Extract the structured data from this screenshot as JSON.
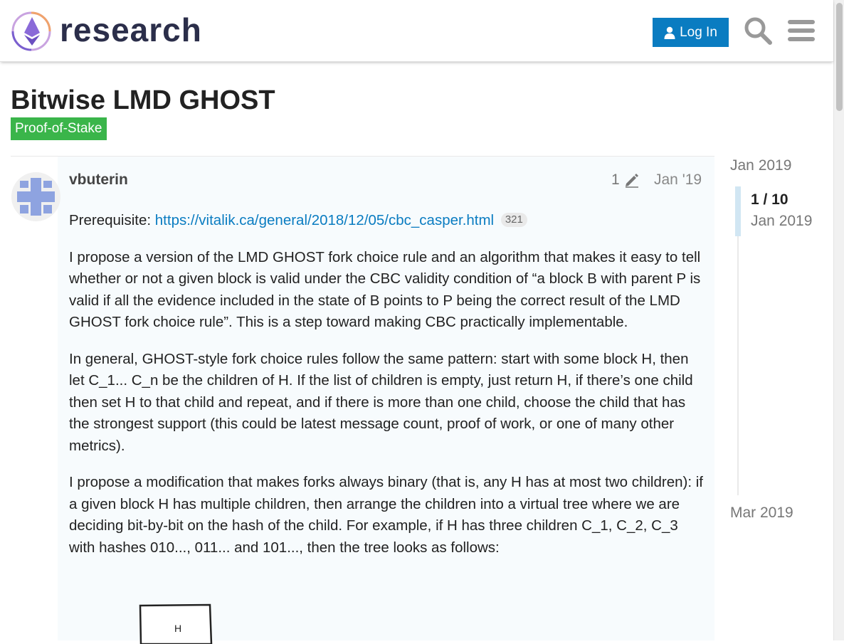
{
  "header": {
    "site_name": "research",
    "login_label": "Log In",
    "icons": [
      "logo-icon",
      "user-icon",
      "search-icon",
      "hamburger-menu-icon"
    ]
  },
  "topic": {
    "title": "Bitwise LMD GHOST",
    "category": "Proof-of-Stake",
    "category_color": "#3ab54a"
  },
  "post": {
    "username": "vbuterin",
    "edit_count": "1",
    "date": "Jan '19",
    "prereq_label": "Prerequisite: ",
    "prereq_link": "https://vitalik.ca/general/2018/12/05/cbc_casper.html",
    "prereq_clicks": "321",
    "paragraphs": [
      "I propose a version of the LMD GHOST fork choice rule and an algorithm that makes it easy to tell whether or not a given block is valid under the CBC validity condition of “a block B with parent P is valid if all the evidence included in the state of B points to P being the correct result of the LMD GHOST fork choice rule”. This is a step toward making CBC practically implementable.",
      "In general, GHOST-style fork choice rules follow the same pattern: start with some block H, then let C_1... C_n be the children of H. If the list of children is empty, just return H, if there’s one child then set H to that child and repeat, and if there is more than one child, choose the child that has the strongest support (this could be latest message count, proof of work, or one of many other metrics).",
      "I propose a modification that makes forks always binary (that is, any H has at most two children): if a given block H has multiple children, then arrange the children into a virtual tree where we are deciding bit-by-bit on the hash of the child. For example, if H has three children C_1, C_2, C_3 with hashes 010..., 011... and 101..., then the tree looks as follows:"
    ],
    "diagram_label": "H"
  },
  "timeline": {
    "start_date": "Jan 2019",
    "position": "1 / 10",
    "current_date": "Jan 2019",
    "end_date": "Mar 2019"
  },
  "colors": {
    "accent": "#0a7cc1",
    "post_bg": "#f7fbfd",
    "timeline_handle": "#d1e6f3"
  }
}
